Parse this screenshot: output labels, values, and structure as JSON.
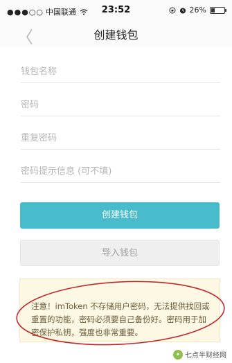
{
  "status_bar": {
    "signal": "●●●○○",
    "carrier": "中国联通",
    "wifi_icon": "wifi-icon",
    "time": "23:52",
    "battery_percent": "26%",
    "battery_level": 0.26
  },
  "nav": {
    "back_icon": "chevron-left-icon",
    "back_glyph": "〈",
    "title": "创建钱包"
  },
  "form": {
    "wallet_name_placeholder": "钱包名称",
    "password_placeholder": "密码",
    "repeat_password_placeholder": "重复密码",
    "hint_placeholder": "密码提示信息 (可不填)"
  },
  "buttons": {
    "create_label": "创建钱包",
    "import_label": "导入钱包"
  },
  "notice": {
    "text": "注意！imToken 不存储用户密码，无法提供找回或重置的功能，密码必须要自己备份好。密码用于加密保护私钥，强度也非常重要。"
  },
  "watermark": {
    "text": "七点半财经网"
  },
  "colors": {
    "accent": "#48bccb",
    "annotation": "#c0282d"
  }
}
